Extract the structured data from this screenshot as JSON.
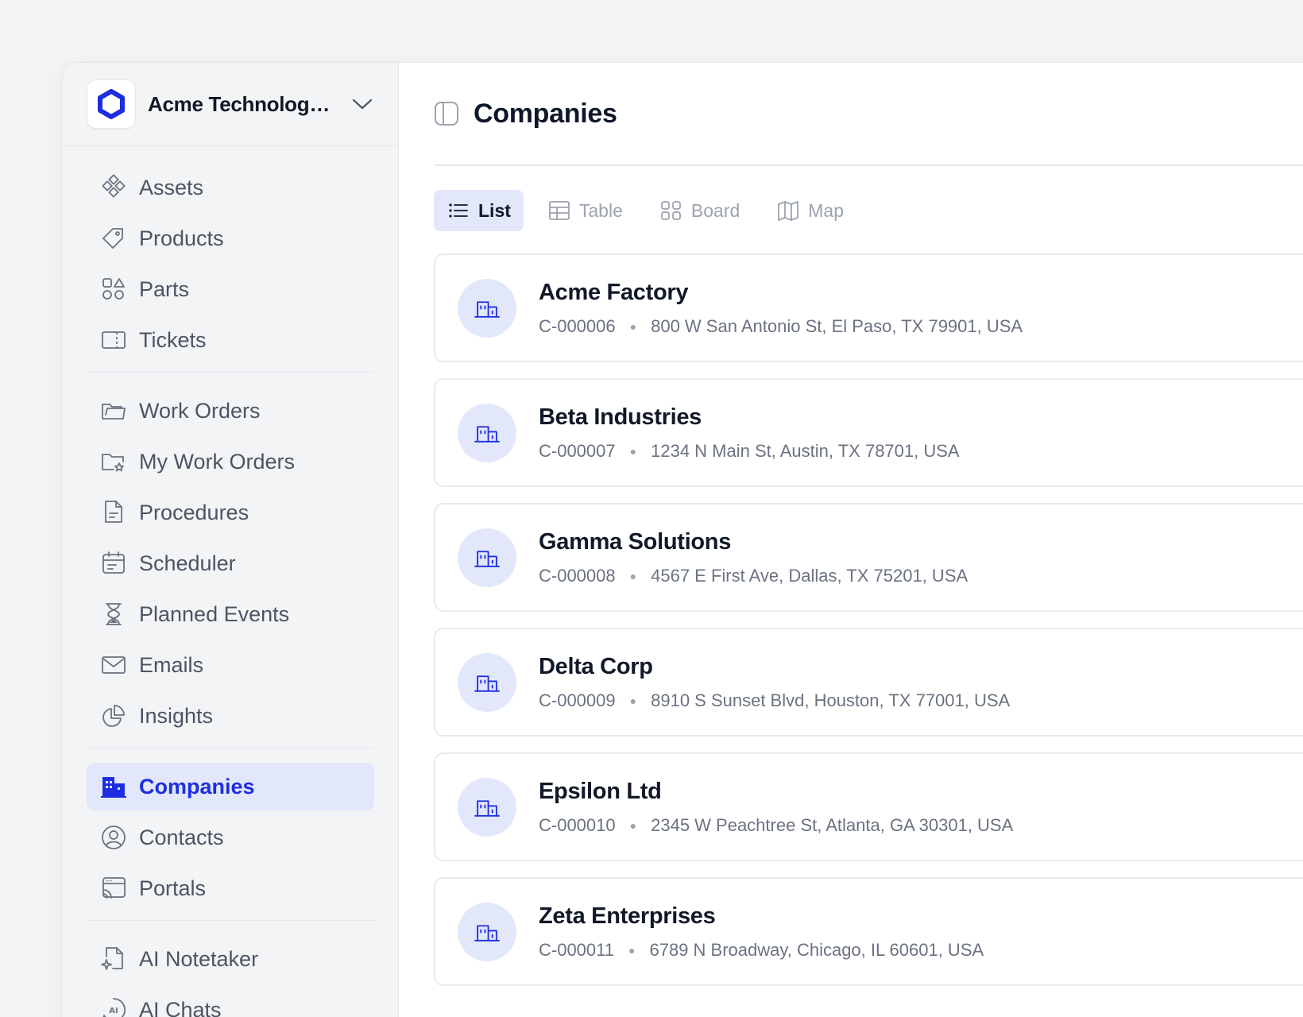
{
  "org": {
    "name": "Acme Technologies"
  },
  "sidebar": {
    "groups": [
      [
        {
          "label": "Assets",
          "icon": "assets-icon"
        },
        {
          "label": "Products",
          "icon": "tag-icon"
        },
        {
          "label": "Parts",
          "icon": "shapes-icon"
        },
        {
          "label": "Tickets",
          "icon": "ticket-icon"
        }
      ],
      [
        {
          "label": "Work Orders",
          "icon": "folder-icon"
        },
        {
          "label": "My Work Orders",
          "icon": "folder-star-icon"
        },
        {
          "label": "Procedures",
          "icon": "document-icon"
        },
        {
          "label": "Scheduler",
          "icon": "calendar-icon"
        },
        {
          "label": "Planned Events",
          "icon": "hourglass-icon"
        },
        {
          "label": "Emails",
          "icon": "mail-icon"
        },
        {
          "label": "Insights",
          "icon": "pie-chart-icon"
        }
      ],
      [
        {
          "label": "Companies",
          "icon": "building-icon",
          "active": true
        },
        {
          "label": "Contacts",
          "icon": "user-circle-icon"
        },
        {
          "label": "Portals",
          "icon": "portal-icon"
        }
      ],
      [
        {
          "label": "AI Notetaker",
          "icon": "ai-note-icon"
        },
        {
          "label": "AI Chats",
          "icon": "ai-chat-icon"
        }
      ]
    ]
  },
  "header": {
    "title": "Companies"
  },
  "views": [
    {
      "label": "List",
      "icon": "list-icon",
      "active": true
    },
    {
      "label": "Table",
      "icon": "table-icon"
    },
    {
      "label": "Board",
      "icon": "board-icon"
    },
    {
      "label": "Map",
      "icon": "map-icon"
    }
  ],
  "companies": [
    {
      "name": "Acme Factory",
      "id": "C-000006",
      "address": "800 W San Antonio St, El Paso, TX 79901, USA"
    },
    {
      "name": "Beta Industries",
      "id": "C-000007",
      "address": "1234 N Main St, Austin, TX 78701, USA"
    },
    {
      "name": "Gamma Solutions",
      "id": "C-000008",
      "address": "4567 E First Ave, Dallas, TX 75201, USA"
    },
    {
      "name": "Delta Corp",
      "id": "C-000009",
      "address": "8910 S Sunset Blvd, Houston, TX 77001, USA"
    },
    {
      "name": "Epsilon Ltd",
      "id": "C-000010",
      "address": "2345 W Peachtree St, Atlanta, GA 30301, USA"
    },
    {
      "name": "Zeta Enterprises",
      "id": "C-000011",
      "address": "6789 N Broadway, Chicago, IL 60601, USA"
    }
  ],
  "colors": {
    "accent": "#1d2ee0",
    "accent_bg": "#e3e7fb",
    "muted": "#6b7280"
  }
}
